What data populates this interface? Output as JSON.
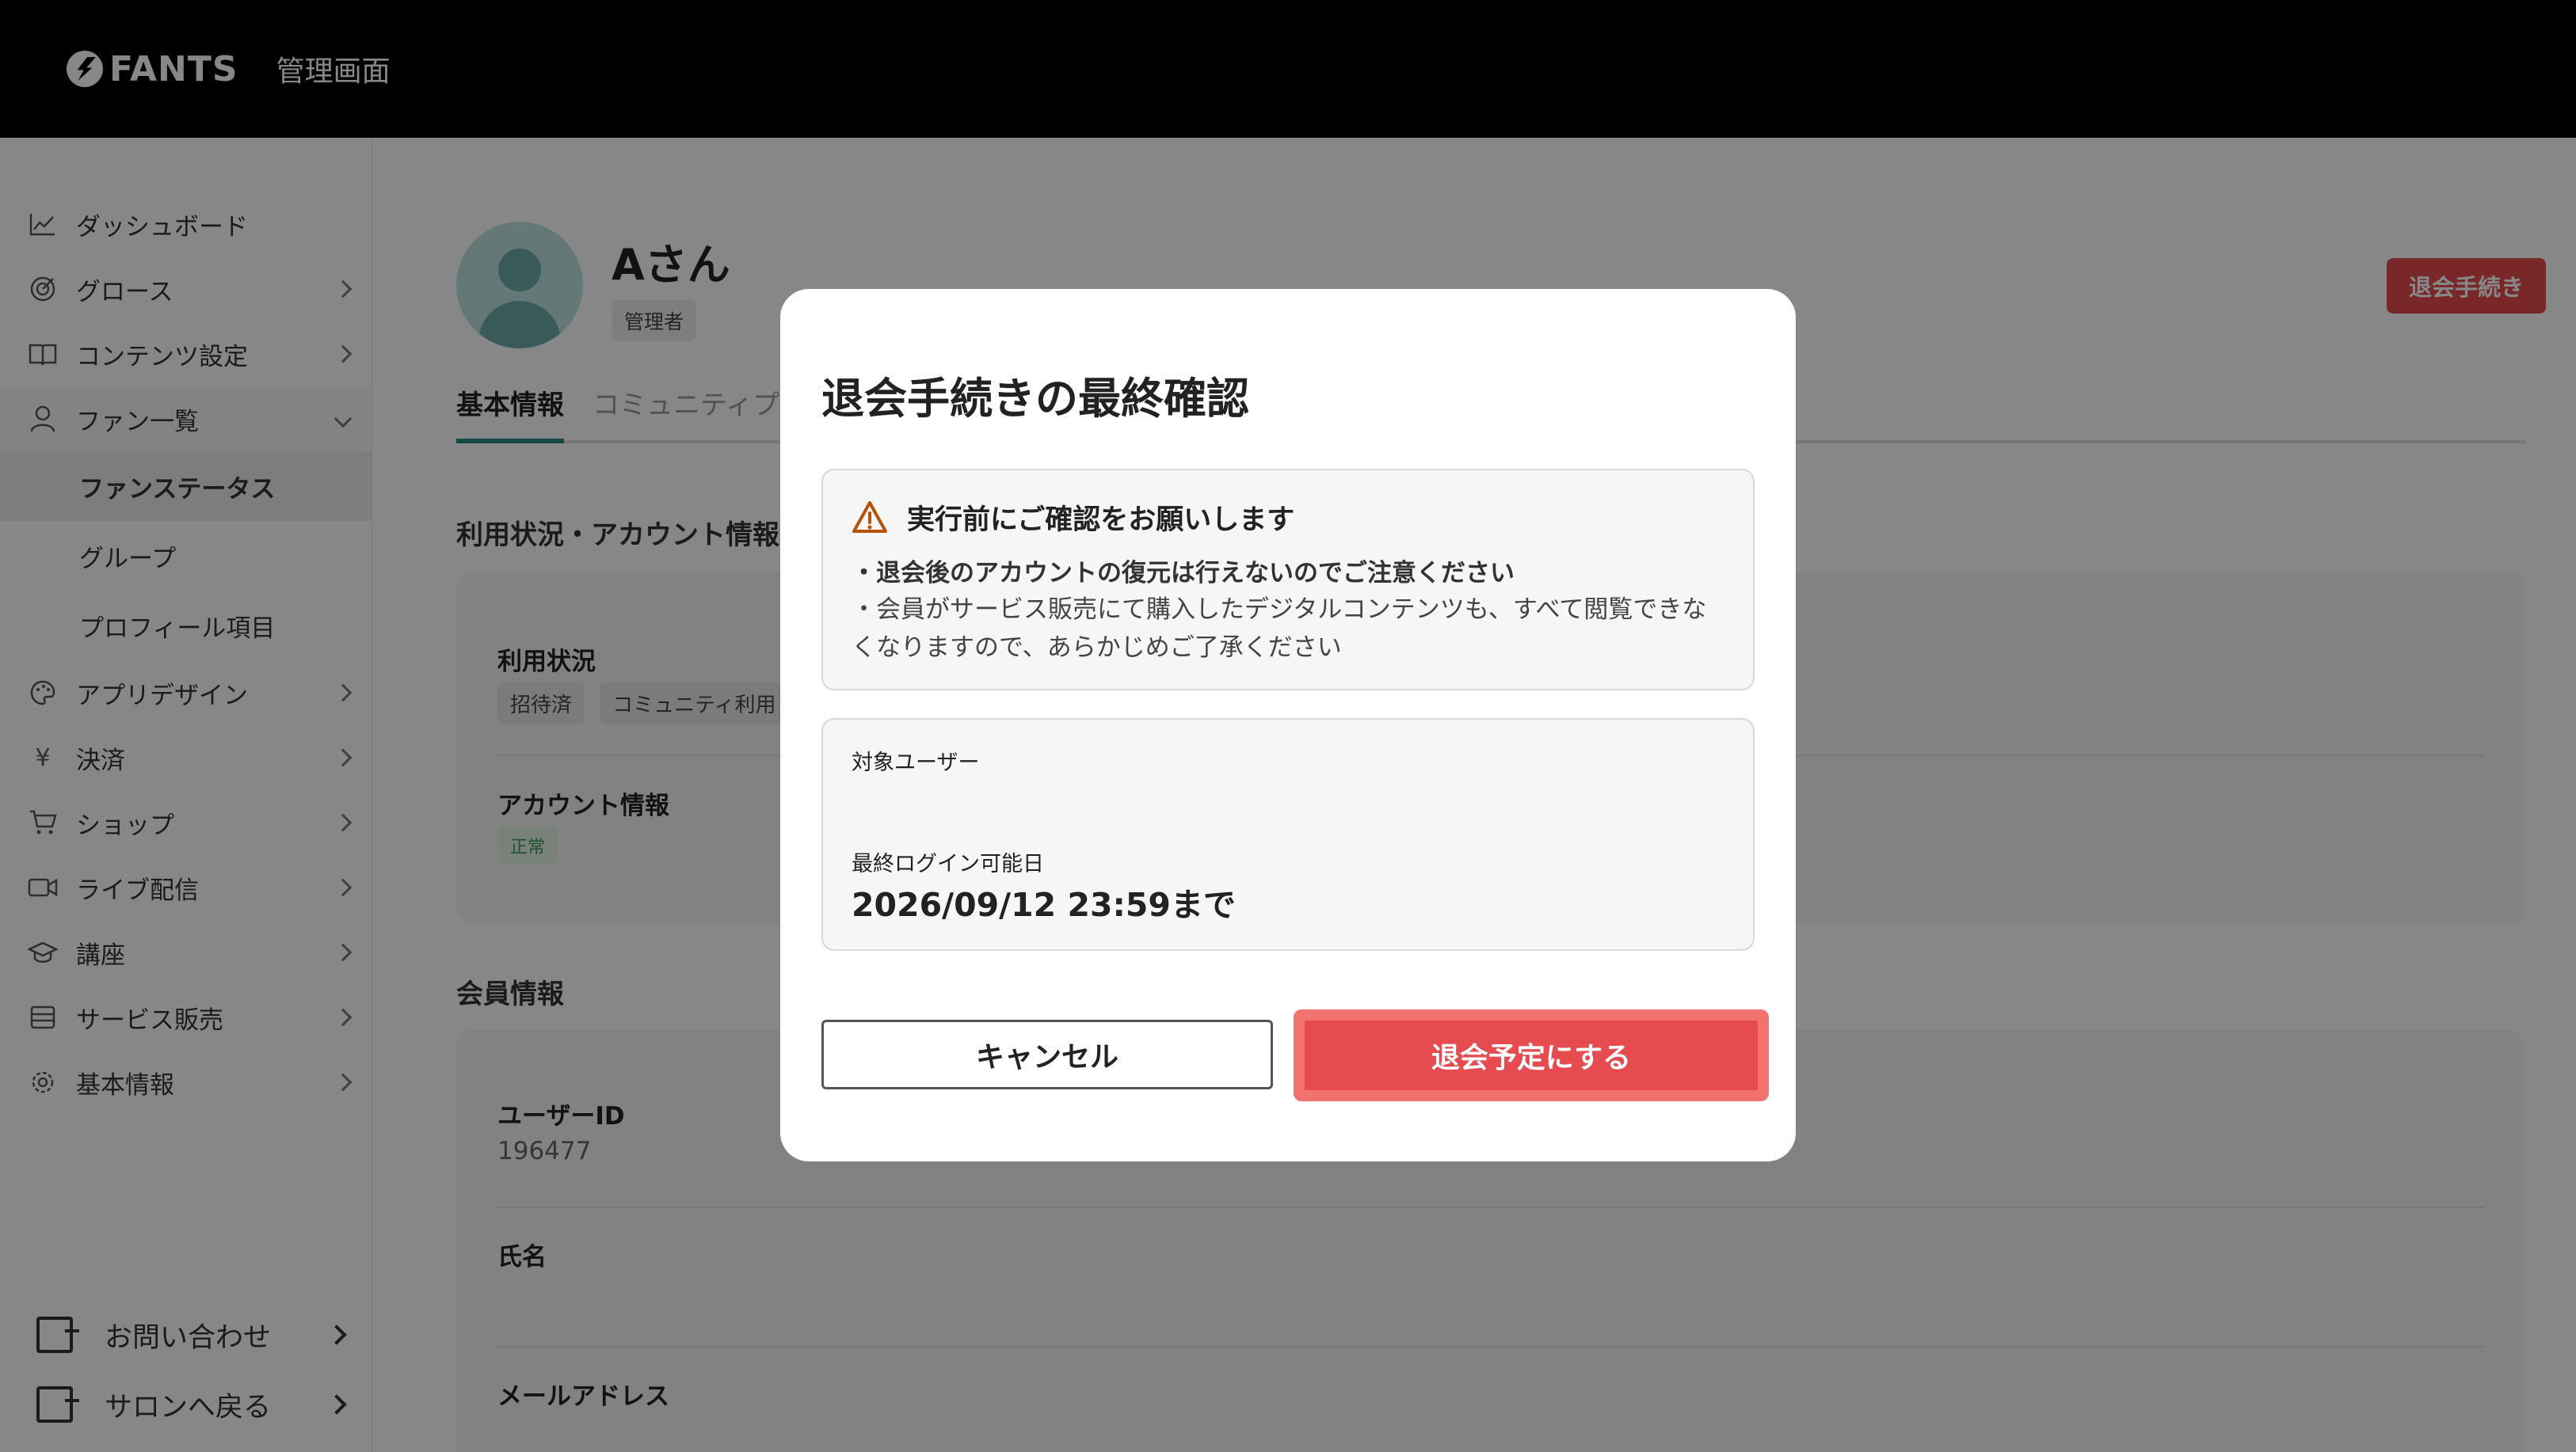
{
  "header": {
    "logo_text": "FANTS",
    "title": "管理画面"
  },
  "sidebar": {
    "items": [
      {
        "label": "ダッシュボード",
        "icon": "chart-line-icon",
        "has_chevron": false
      },
      {
        "label": "グロース",
        "icon": "target-icon",
        "has_chevron": true
      },
      {
        "label": "コンテンツ設定",
        "icon": "book-icon",
        "has_chevron": true
      },
      {
        "label": "ファン一覧",
        "icon": "user-icon",
        "has_chevron": true,
        "expanded": true,
        "sub_items": [
          "ファンステータス",
          "グループ",
          "プロフィール項目"
        ],
        "selected_sub": "ファンステータス"
      },
      {
        "label": "アプリデザイン",
        "icon": "palette-icon",
        "has_chevron": true
      },
      {
        "label": "決済",
        "icon": "yen-icon",
        "has_chevron": true
      },
      {
        "label": "ショップ",
        "icon": "cart-icon",
        "has_chevron": true
      },
      {
        "label": "ライブ配信",
        "icon": "video-icon",
        "has_chevron": true
      },
      {
        "label": "講座",
        "icon": "graduation-cap-icon",
        "has_chevron": true
      },
      {
        "label": "サービス販売",
        "icon": "store-icon",
        "has_chevron": true
      },
      {
        "label": "基本情報",
        "icon": "gear-icon",
        "has_chevron": true
      }
    ],
    "footer": [
      {
        "label": "お問い合わせ",
        "icon": "exit-icon"
      },
      {
        "label": "サロンへ戻る",
        "icon": "exit-icon"
      }
    ]
  },
  "profile": {
    "name": "Aさん",
    "role": "管理者",
    "withdraw_button": "退会手続き"
  },
  "tabs": [
    "基本情報",
    "コミュニティプ"
  ],
  "usage_section": {
    "title": "利用状況・アカウント情報",
    "usage_label": "利用状況",
    "usage_chips": [
      "招待済",
      "コミュニティ利用"
    ],
    "account_label": "アカウント情報",
    "account_status": "正常"
  },
  "member_section": {
    "title": "会員情報",
    "user_id_label": "ユーザーID",
    "user_id": "196477",
    "name_label": "氏名",
    "email_label": "メールアドレス"
  },
  "modal": {
    "title": "退会手続きの最終確認",
    "warning_title": "実行前にご確認をお願いします",
    "warning_line1": "・退会後のアカウントの復元は行えないのでご注意ください",
    "warning_line2": "・会員がサービス販売にて購入したデジタルコンテンツも、すべて閲覧できなくなりますので、あらかじめご了承ください",
    "target_user_label": "対象ユーザー",
    "last_login_label": "最終ログイン可能日",
    "last_login_value": "2026/09/12 23:59まで",
    "cancel_label": "キャンセル",
    "confirm_label": "退会予定にする"
  },
  "colors": {
    "accent": "#2d8a8a",
    "danger": "#e64b4f",
    "warning_icon": "#b45309"
  }
}
